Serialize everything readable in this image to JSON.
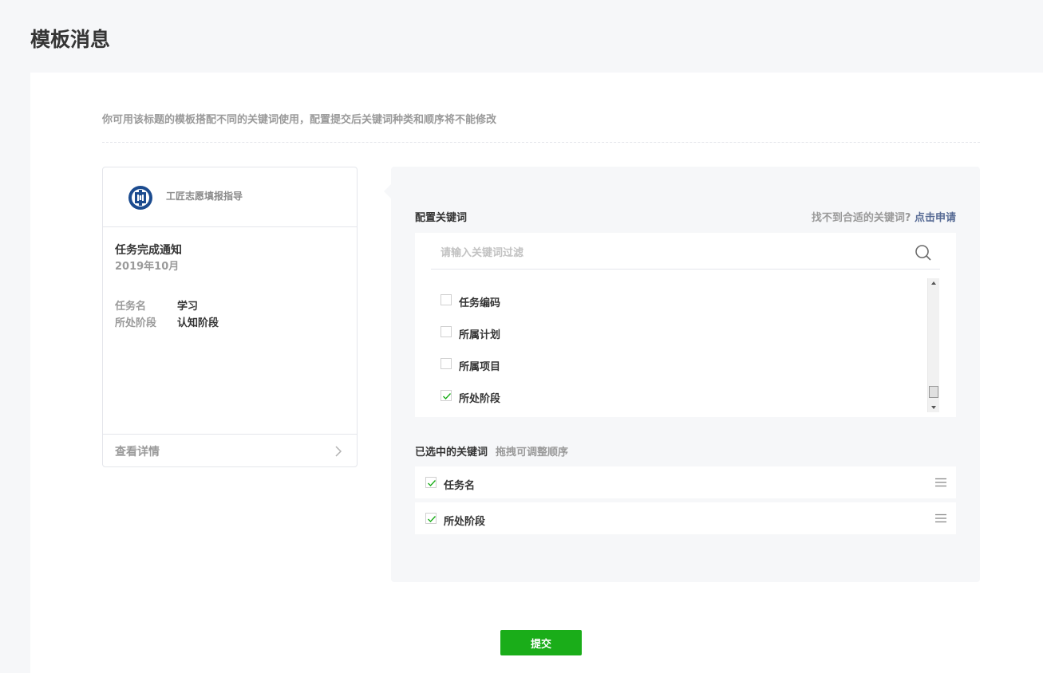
{
  "page_title": "模板消息",
  "tip": "你可用该标题的模板搭配不同的关键词使用，配置提交后关键词种类和顺序将不能修改",
  "preview": {
    "account_name": "工匠志愿填报指导",
    "message_title": "任务完成通知",
    "date": "2019年10月",
    "fields": [
      {
        "key": "任务名",
        "value": "学习"
      },
      {
        "key": "所处阶段",
        "value": "认知阶段"
      }
    ],
    "detail_label": "查看详情"
  },
  "config": {
    "label": "配置关键词",
    "help_text": "找不到合适的关键词?",
    "help_link": "点击申请",
    "search_placeholder": "请输入关键词过滤",
    "keywords": [
      {
        "label": "任务编码",
        "checked": false
      },
      {
        "label": "所属计划",
        "checked": false
      },
      {
        "label": "所属项目",
        "checked": false
      },
      {
        "label": "所处阶段",
        "checked": true
      }
    ],
    "selected_label": "已选中的关键词",
    "selected_hint": "拖拽可调整顺序",
    "selected": [
      {
        "label": "任务名",
        "checked": true
      },
      {
        "label": "所处阶段",
        "checked": true
      }
    ]
  },
  "submit_label": "提交",
  "colors": {
    "accent_green": "#1aad19",
    "link_blue": "#576b95",
    "logo_blue": "#1b4b8f"
  }
}
